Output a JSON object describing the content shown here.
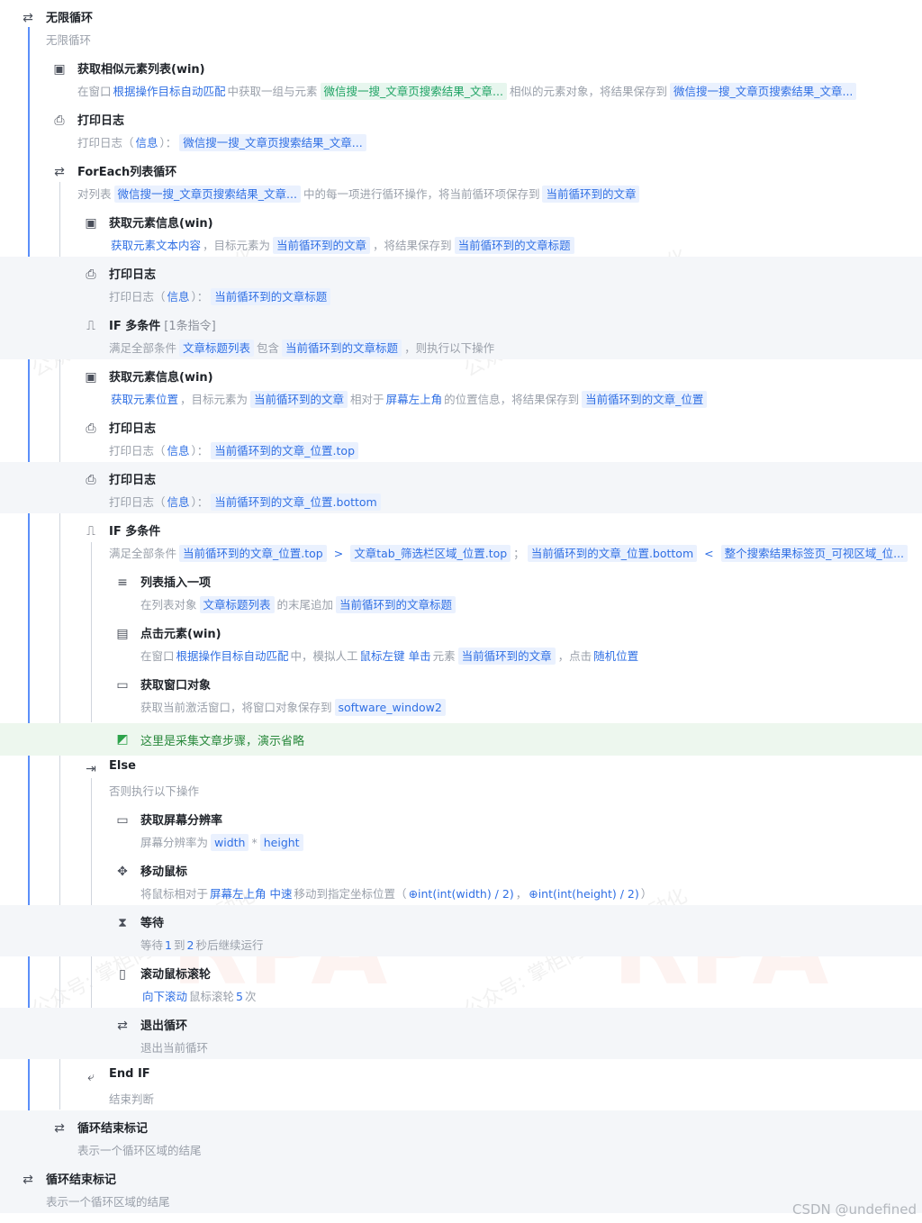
{
  "credit": "CSDN @undefined",
  "watermark": "RPA",
  "watermark_small": "公众号: 掌柜向嘿RPA自动化",
  "steps": [
    {
      "title": "无限循环",
      "icon": "loop-icon",
      "desc": [
        {
          "t": "text",
          "v": "无限循环"
        }
      ]
    },
    {
      "title": "获取相似元素列表(win)",
      "icon": "window-element-icon",
      "desc": [
        {
          "t": "text",
          "v": "在窗口"
        },
        {
          "t": "kw",
          "v": "根据操作目标自动匹配"
        },
        {
          "t": "text",
          "v": "中获取一组与元素"
        },
        {
          "t": "chipg",
          "v": "微信搜一搜_文章页搜索结果_文章..."
        },
        {
          "t": "text",
          "v": "相似的元素对象，将结果保存到"
        },
        {
          "t": "chip",
          "v": "微信搜一搜_文章页搜索结果_文章..."
        }
      ]
    },
    {
      "title": "打印日志",
      "icon": "printer-icon",
      "desc": [
        {
          "t": "text",
          "v": "打印日志（"
        },
        {
          "t": "kw",
          "v": "信息"
        },
        {
          "t": "text",
          "v": "）："
        },
        {
          "t": "chip",
          "v": "微信搜一搜_文章页搜索结果_文章..."
        }
      ]
    },
    {
      "title": "ForEach列表循环",
      "icon": "loop-icon",
      "desc": [
        {
          "t": "text",
          "v": "对列表"
        },
        {
          "t": "chip",
          "v": "微信搜一搜_文章页搜索结果_文章..."
        },
        {
          "t": "text",
          "v": "中的每一项进行循环操作，将当前循环项保存到"
        },
        {
          "t": "chip",
          "v": "当前循环到的文章"
        }
      ]
    },
    {
      "title": "获取元素信息(win)",
      "icon": "window-element-icon",
      "desc": [
        {
          "t": "kw",
          "v": "获取元素文本内容"
        },
        {
          "t": "text",
          "v": "，目标元素为"
        },
        {
          "t": "chip",
          "v": "当前循环到的文章"
        },
        {
          "t": "text",
          "v": "，将结果保存到"
        },
        {
          "t": "chip",
          "v": "当前循环到的文章标题"
        }
      ]
    },
    {
      "title": "打印日志",
      "icon": "printer-icon",
      "desc": [
        {
          "t": "text",
          "v": "打印日志（"
        },
        {
          "t": "kw",
          "v": "信息"
        },
        {
          "t": "text",
          "v": "）："
        },
        {
          "t": "chip",
          "v": "当前循环到的文章标题"
        }
      ]
    },
    {
      "title": "IF 多条件",
      "extra": "[1条指令]",
      "icon": "branch-icon",
      "desc": [
        {
          "t": "text",
          "v": "满足全部条件"
        },
        {
          "t": "chip",
          "v": "文章标题列表"
        },
        {
          "t": "text",
          "v": "包含"
        },
        {
          "t": "chip",
          "v": "当前循环到的文章标题"
        },
        {
          "t": "text",
          "v": "，则执行以下操作"
        }
      ]
    },
    {
      "title": "获取元素信息(win)",
      "icon": "window-element-icon",
      "desc": [
        {
          "t": "kw",
          "v": "获取元素位置"
        },
        {
          "t": "text",
          "v": "，目标元素为"
        },
        {
          "t": "chip",
          "v": "当前循环到的文章"
        },
        {
          "t": "text",
          "v": "相对于"
        },
        {
          "t": "kw",
          "v": "屏幕左上角"
        },
        {
          "t": "text",
          "v": "的位置信息，将结果保存到"
        },
        {
          "t": "chip",
          "v": "当前循环到的文章_位置"
        }
      ]
    },
    {
      "title": "打印日志",
      "icon": "printer-icon",
      "desc": [
        {
          "t": "text",
          "v": "打印日志（"
        },
        {
          "t": "kw",
          "v": "信息"
        },
        {
          "t": "text",
          "v": "）："
        },
        {
          "t": "chip",
          "v": "当前循环到的文章_位置.top"
        }
      ]
    },
    {
      "title": "打印日志",
      "icon": "printer-icon",
      "desc": [
        {
          "t": "text",
          "v": "打印日志（"
        },
        {
          "t": "kw",
          "v": "信息"
        },
        {
          "t": "text",
          "v": "）："
        },
        {
          "t": "chip",
          "v": "当前循环到的文章_位置.bottom"
        }
      ]
    },
    {
      "title": "IF 多条件",
      "icon": "branch-icon",
      "desc": [
        {
          "t": "text",
          "v": "满足全部条件"
        },
        {
          "t": "chip",
          "v": "当前循环到的文章_位置.top"
        },
        {
          "t": "op",
          "v": ">"
        },
        {
          "t": "chip",
          "v": "文章tab_筛选栏区域_位置.top"
        },
        {
          "t": "text",
          "v": "；"
        },
        {
          "t": "chip",
          "v": "当前循环到的文章_位置.bottom"
        },
        {
          "t": "op",
          "v": "<"
        },
        {
          "t": "chip",
          "v": "整个搜索结果标签页_可视区域_位..."
        }
      ]
    },
    {
      "title": "列表插入一项",
      "icon": "list-add-icon",
      "desc": [
        {
          "t": "text",
          "v": "在列表对象"
        },
        {
          "t": "chip",
          "v": "文章标题列表"
        },
        {
          "t": "text",
          "v": "的末尾追加"
        },
        {
          "t": "chip",
          "v": "当前循环到的文章标题"
        }
      ]
    },
    {
      "title": "点击元素(win)",
      "icon": "click-element-icon",
      "desc": [
        {
          "t": "text",
          "v": "在窗口"
        },
        {
          "t": "kw",
          "v": "根据操作目标自动匹配"
        },
        {
          "t": "text",
          "v": "中，模拟人工"
        },
        {
          "t": "kw",
          "v": "鼠标左键"
        },
        {
          "t": "kw",
          "v": "单击"
        },
        {
          "t": "text",
          "v": "元素"
        },
        {
          "t": "chip",
          "v": "当前循环到的文章"
        },
        {
          "t": "text",
          "v": "，点击"
        },
        {
          "t": "kw",
          "v": "随机位置"
        }
      ]
    },
    {
      "title": "获取窗口对象",
      "icon": "window-icon",
      "desc": [
        {
          "t": "text",
          "v": "获取当前激活窗口，将窗口对象保存到"
        },
        {
          "t": "chip",
          "v": "software_window2"
        }
      ]
    },
    {
      "title": "这里是采集文章步骤，演示省略",
      "icon": "note-icon",
      "desc": []
    },
    {
      "title": "Else",
      "icon": "else-icon",
      "desc": [
        {
          "t": "text",
          "v": "否则执行以下操作"
        }
      ]
    },
    {
      "title": "获取屏幕分辨率",
      "icon": "monitor-icon",
      "desc": [
        {
          "t": "text",
          "v": "屏幕分辨率为"
        },
        {
          "t": "chip",
          "v": "width"
        },
        {
          "t": "text",
          "v": "*"
        },
        {
          "t": "chip",
          "v": "height"
        }
      ]
    },
    {
      "title": "移动鼠标",
      "icon": "mouse-move-icon",
      "desc": [
        {
          "t": "text",
          "v": "将鼠标相对于"
        },
        {
          "t": "kw",
          "v": "屏幕左上角"
        },
        {
          "t": "kw",
          "v": "中速"
        },
        {
          "t": "text",
          "v": "移动到指定坐标位置（"
        },
        {
          "t": "kw",
          "v": "⊕int(int(width) / 2)"
        },
        {
          "t": "text",
          "v": "，"
        },
        {
          "t": "kw",
          "v": "⊕int(int(height) / 2)"
        },
        {
          "t": "text",
          "v": "）"
        }
      ]
    },
    {
      "title": "等待",
      "icon": "hourglass-icon",
      "desc": [
        {
          "t": "text",
          "v": "等待"
        },
        {
          "t": "kw",
          "v": "1"
        },
        {
          "t": "text",
          "v": "到"
        },
        {
          "t": "kw",
          "v": "2"
        },
        {
          "t": "text",
          "v": "秒后继续运行"
        }
      ]
    },
    {
      "title": "滚动鼠标滚轮",
      "icon": "scroll-icon",
      "desc": [
        {
          "t": "kw",
          "v": "向下滚动"
        },
        {
          "t": "text",
          "v": "鼠标滚轮"
        },
        {
          "t": "kw",
          "v": "5"
        },
        {
          "t": "text",
          "v": "次"
        }
      ]
    },
    {
      "title": "退出循环",
      "icon": "exit-loop-icon",
      "desc": [
        {
          "t": "text",
          "v": "退出当前循环"
        }
      ]
    },
    {
      "title": "End IF",
      "icon": "end-if-icon",
      "desc": [
        {
          "t": "text",
          "v": "结束判断"
        }
      ]
    },
    {
      "title": "循环结束标记",
      "icon": "loop-end-icon",
      "desc": [
        {
          "t": "text",
          "v": "表示一个循环区域的结尾"
        }
      ]
    },
    {
      "title": "循环结束标记",
      "icon": "loop-end-icon",
      "desc": [
        {
          "t": "text",
          "v": "表示一个循环区域的结尾"
        }
      ]
    }
  ]
}
